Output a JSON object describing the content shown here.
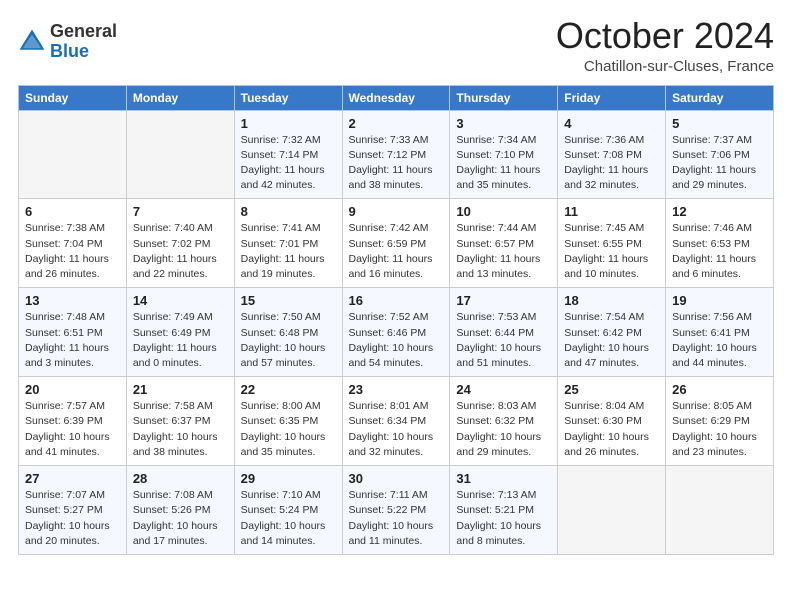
{
  "header": {
    "logo_general": "General",
    "logo_blue": "Blue",
    "month_title": "October 2024",
    "subtitle": "Chatillon-sur-Cluses, France"
  },
  "weekdays": [
    "Sunday",
    "Monday",
    "Tuesday",
    "Wednesday",
    "Thursday",
    "Friday",
    "Saturday"
  ],
  "weeks": [
    [
      {
        "day": "",
        "sunrise": "",
        "sunset": "",
        "daylight": ""
      },
      {
        "day": "",
        "sunrise": "",
        "sunset": "",
        "daylight": ""
      },
      {
        "day": "1",
        "sunrise": "Sunrise: 7:32 AM",
        "sunset": "Sunset: 7:14 PM",
        "daylight": "Daylight: 11 hours and 42 minutes."
      },
      {
        "day": "2",
        "sunrise": "Sunrise: 7:33 AM",
        "sunset": "Sunset: 7:12 PM",
        "daylight": "Daylight: 11 hours and 38 minutes."
      },
      {
        "day": "3",
        "sunrise": "Sunrise: 7:34 AM",
        "sunset": "Sunset: 7:10 PM",
        "daylight": "Daylight: 11 hours and 35 minutes."
      },
      {
        "day": "4",
        "sunrise": "Sunrise: 7:36 AM",
        "sunset": "Sunset: 7:08 PM",
        "daylight": "Daylight: 11 hours and 32 minutes."
      },
      {
        "day": "5",
        "sunrise": "Sunrise: 7:37 AM",
        "sunset": "Sunset: 7:06 PM",
        "daylight": "Daylight: 11 hours and 29 minutes."
      }
    ],
    [
      {
        "day": "6",
        "sunrise": "Sunrise: 7:38 AM",
        "sunset": "Sunset: 7:04 PM",
        "daylight": "Daylight: 11 hours and 26 minutes."
      },
      {
        "day": "7",
        "sunrise": "Sunrise: 7:40 AM",
        "sunset": "Sunset: 7:02 PM",
        "daylight": "Daylight: 11 hours and 22 minutes."
      },
      {
        "day": "8",
        "sunrise": "Sunrise: 7:41 AM",
        "sunset": "Sunset: 7:01 PM",
        "daylight": "Daylight: 11 hours and 19 minutes."
      },
      {
        "day": "9",
        "sunrise": "Sunrise: 7:42 AM",
        "sunset": "Sunset: 6:59 PM",
        "daylight": "Daylight: 11 hours and 16 minutes."
      },
      {
        "day": "10",
        "sunrise": "Sunrise: 7:44 AM",
        "sunset": "Sunset: 6:57 PM",
        "daylight": "Daylight: 11 hours and 13 minutes."
      },
      {
        "day": "11",
        "sunrise": "Sunrise: 7:45 AM",
        "sunset": "Sunset: 6:55 PM",
        "daylight": "Daylight: 11 hours and 10 minutes."
      },
      {
        "day": "12",
        "sunrise": "Sunrise: 7:46 AM",
        "sunset": "Sunset: 6:53 PM",
        "daylight": "Daylight: 11 hours and 6 minutes."
      }
    ],
    [
      {
        "day": "13",
        "sunrise": "Sunrise: 7:48 AM",
        "sunset": "Sunset: 6:51 PM",
        "daylight": "Daylight: 11 hours and 3 minutes."
      },
      {
        "day": "14",
        "sunrise": "Sunrise: 7:49 AM",
        "sunset": "Sunset: 6:49 PM",
        "daylight": "Daylight: 11 hours and 0 minutes."
      },
      {
        "day": "15",
        "sunrise": "Sunrise: 7:50 AM",
        "sunset": "Sunset: 6:48 PM",
        "daylight": "Daylight: 10 hours and 57 minutes."
      },
      {
        "day": "16",
        "sunrise": "Sunrise: 7:52 AM",
        "sunset": "Sunset: 6:46 PM",
        "daylight": "Daylight: 10 hours and 54 minutes."
      },
      {
        "day": "17",
        "sunrise": "Sunrise: 7:53 AM",
        "sunset": "Sunset: 6:44 PM",
        "daylight": "Daylight: 10 hours and 51 minutes."
      },
      {
        "day": "18",
        "sunrise": "Sunrise: 7:54 AM",
        "sunset": "Sunset: 6:42 PM",
        "daylight": "Daylight: 10 hours and 47 minutes."
      },
      {
        "day": "19",
        "sunrise": "Sunrise: 7:56 AM",
        "sunset": "Sunset: 6:41 PM",
        "daylight": "Daylight: 10 hours and 44 minutes."
      }
    ],
    [
      {
        "day": "20",
        "sunrise": "Sunrise: 7:57 AM",
        "sunset": "Sunset: 6:39 PM",
        "daylight": "Daylight: 10 hours and 41 minutes."
      },
      {
        "day": "21",
        "sunrise": "Sunrise: 7:58 AM",
        "sunset": "Sunset: 6:37 PM",
        "daylight": "Daylight: 10 hours and 38 minutes."
      },
      {
        "day": "22",
        "sunrise": "Sunrise: 8:00 AM",
        "sunset": "Sunset: 6:35 PM",
        "daylight": "Daylight: 10 hours and 35 minutes."
      },
      {
        "day": "23",
        "sunrise": "Sunrise: 8:01 AM",
        "sunset": "Sunset: 6:34 PM",
        "daylight": "Daylight: 10 hours and 32 minutes."
      },
      {
        "day": "24",
        "sunrise": "Sunrise: 8:03 AM",
        "sunset": "Sunset: 6:32 PM",
        "daylight": "Daylight: 10 hours and 29 minutes."
      },
      {
        "day": "25",
        "sunrise": "Sunrise: 8:04 AM",
        "sunset": "Sunset: 6:30 PM",
        "daylight": "Daylight: 10 hours and 26 minutes."
      },
      {
        "day": "26",
        "sunrise": "Sunrise: 8:05 AM",
        "sunset": "Sunset: 6:29 PM",
        "daylight": "Daylight: 10 hours and 23 minutes."
      }
    ],
    [
      {
        "day": "27",
        "sunrise": "Sunrise: 7:07 AM",
        "sunset": "Sunset: 5:27 PM",
        "daylight": "Daylight: 10 hours and 20 minutes."
      },
      {
        "day": "28",
        "sunrise": "Sunrise: 7:08 AM",
        "sunset": "Sunset: 5:26 PM",
        "daylight": "Daylight: 10 hours and 17 minutes."
      },
      {
        "day": "29",
        "sunrise": "Sunrise: 7:10 AM",
        "sunset": "Sunset: 5:24 PM",
        "daylight": "Daylight: 10 hours and 14 minutes."
      },
      {
        "day": "30",
        "sunrise": "Sunrise: 7:11 AM",
        "sunset": "Sunset: 5:22 PM",
        "daylight": "Daylight: 10 hours and 11 minutes."
      },
      {
        "day": "31",
        "sunrise": "Sunrise: 7:13 AM",
        "sunset": "Sunset: 5:21 PM",
        "daylight": "Daylight: 10 hours and 8 minutes."
      },
      {
        "day": "",
        "sunrise": "",
        "sunset": "",
        "daylight": ""
      },
      {
        "day": "",
        "sunrise": "",
        "sunset": "",
        "daylight": ""
      }
    ]
  ]
}
